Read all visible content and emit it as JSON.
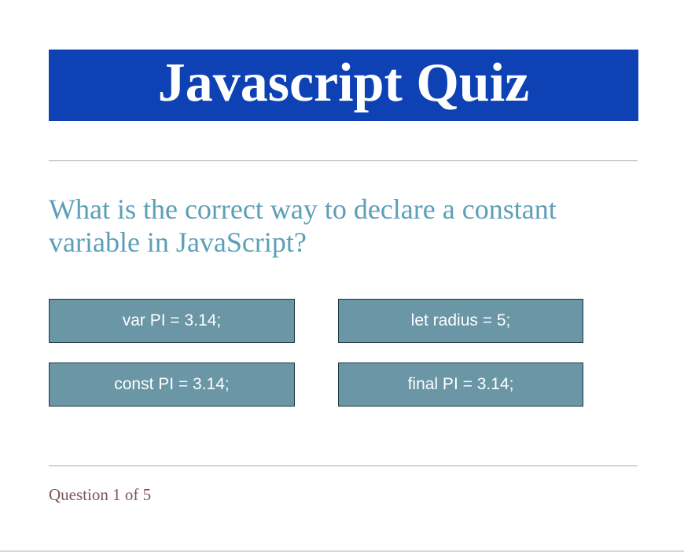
{
  "header": {
    "title": "Javascript Quiz"
  },
  "question": {
    "text": "What is the correct way to declare a constant variable in JavaScript?"
  },
  "answers": [
    {
      "label": "var PI = 3.14;"
    },
    {
      "label": "let radius = 5;"
    },
    {
      "label": "const PI = 3.14;"
    },
    {
      "label": "final PI = 3.14;"
    }
  ],
  "footer": {
    "progress": "Question 1 of 5"
  },
  "colors": {
    "banner_background": "#0e42b4",
    "question_text": "#5b9fb8",
    "answer_background": "#6a96a6",
    "answer_border": "#1d3644",
    "progress_text": "#7d5656"
  }
}
